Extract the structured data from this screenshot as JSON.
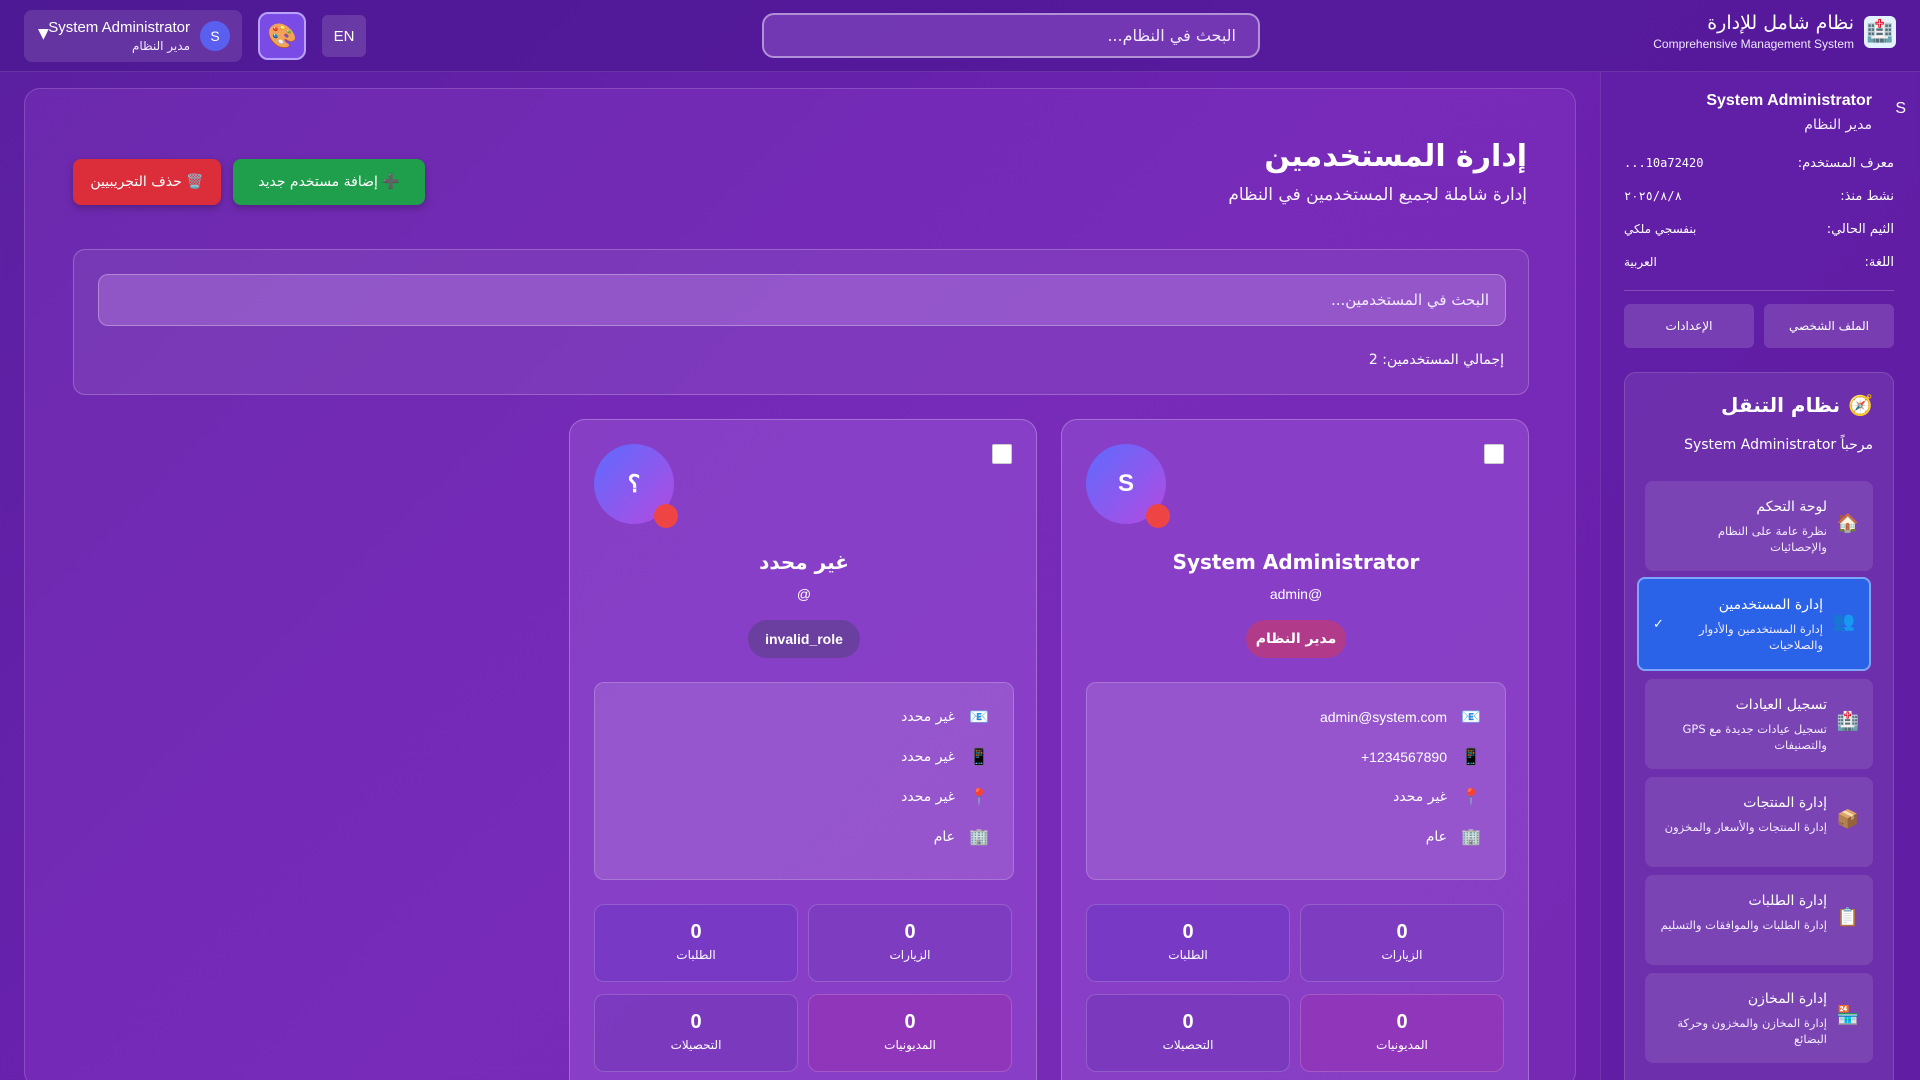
{
  "brand": {
    "title": "نظام شامل للإدارة",
    "subtitle": "Comprehensive Management System",
    "icon": "hospital-icon"
  },
  "topbar": {
    "search_placeholder": "البحث في النظام...",
    "lang_label": "EN",
    "theme_icon": "palette-icon",
    "user_name": "System Administrator",
    "user_role": "مدير النظام",
    "user_initial": "S",
    "caret": "▼"
  },
  "sidebar": {
    "initial": "S",
    "name": "System Administrator",
    "role": "مدير النظام",
    "info": [
      {
        "key": "معرف المستخدم:",
        "value": "10a72420..."
      },
      {
        "key": "نشط منذ:",
        "value": "٢٠٢٥/٨/٨"
      },
      {
        "key": "الثيم الحالي:",
        "value": "بنفسجي ملكي"
      },
      {
        "key": "اللغة:",
        "value": "العربية"
      }
    ],
    "profile_button": "الملف الشخصي",
    "settings_button": "الإعدادات",
    "nav": {
      "title": "نظام التنقل",
      "title_icon": "compass-icon",
      "welcome": "مرحباً System Administrator",
      "items": [
        {
          "title": "لوحة التحكم",
          "desc": "نظرة عامة على النظام والإحصائيات",
          "icon": "home-icon",
          "active": false
        },
        {
          "title": "إدارة المستخدمين",
          "desc": "إدارة المستخدمين والأدوار والصلاحيات",
          "icon": "users-icon",
          "active": true
        },
        {
          "title": "تسجيل العيادات",
          "desc": "تسجيل عيادات جديدة مع GPS والتصنيفات",
          "icon": "hospital-icon",
          "active": false
        },
        {
          "title": "إدارة المنتجات",
          "desc": "إدارة المنتجات والأسعار والمخزون",
          "icon": "package-icon",
          "active": false
        },
        {
          "title": "إدارة الطلبات",
          "desc": "إدارة الطلبات والموافقات والتسليم",
          "icon": "clipboard-icon",
          "active": false
        },
        {
          "title": "إدارة المخازن",
          "desc": "إدارة المخازن والمخزون وحركة البضائع",
          "icon": "warehouse-icon",
          "active": false
        }
      ],
      "active_check": "✓"
    }
  },
  "main": {
    "title": "إدارة المستخدمين",
    "subtitle": "إدارة شاملة لجميع المستخدمين في النظام",
    "add_button": "➕ إضافة مستخدم جديد",
    "delete_button": "🗑️ حذف التجريبيين",
    "search_placeholder": "البحث في المستخدمين...",
    "total_users": "إجمالي المستخدمين: 2"
  },
  "users": [
    {
      "initial": "S",
      "name": "System Administrator",
      "username": "admin@",
      "role": "مدير النظام",
      "role_color": "#b23a8a",
      "email": "admin@system.com",
      "phone": "+1234567890",
      "location": "غير محدد",
      "department": "عام",
      "stats": {
        "visits": "0",
        "orders": "0",
        "debts": "0",
        "collections": "0"
      }
    },
    {
      "initial": "؟",
      "name": "غير محدد",
      "username": "@",
      "role": "invalid_role",
      "role_color": "#6b3fa0",
      "email": "غير محدد",
      "phone": "غير محدد",
      "location": "غير محدد",
      "department": "عام",
      "stats": {
        "visits": "0",
        "orders": "0",
        "debts": "0",
        "collections": "0"
      }
    }
  ],
  "stat_labels": {
    "visits": "الزيارات",
    "orders": "الطلبات",
    "debts": "المديونيات",
    "collections": "التحصيلات"
  },
  "detail_icons": {
    "email": "email-icon",
    "phone": "phone-icon",
    "location": "location-pin-icon",
    "department": "building-icon"
  },
  "colors": {
    "accent": "#2b63e8",
    "add": "#1f9e4b",
    "delete": "#dc2d3a",
    "offline": "#ee4444"
  }
}
